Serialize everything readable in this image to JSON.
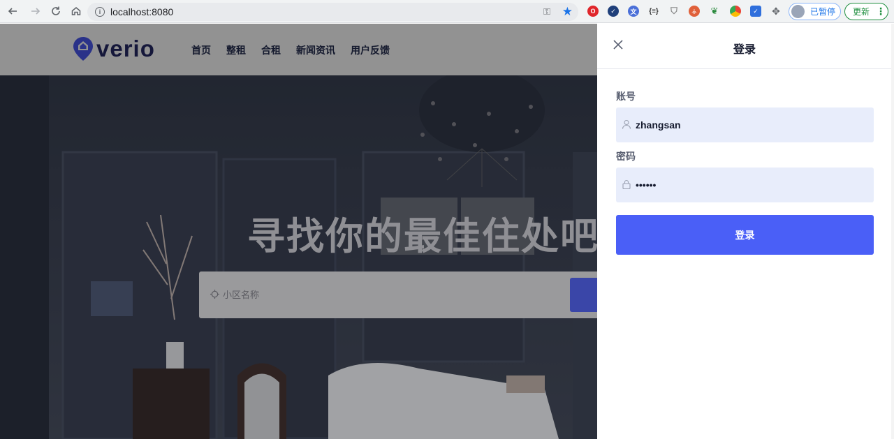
{
  "browser": {
    "url": "localhost:8080",
    "profile_status": "已暂停",
    "update_label": "更新",
    "extensions": [
      "opera-icon",
      "checkmark-icon",
      "translate-icon",
      "json-icon",
      "shield-icon",
      "tree-icon",
      "leaf-icon",
      "chrome-icon",
      "todo-icon",
      "puzzle-icon"
    ]
  },
  "site": {
    "logo_text": "verio",
    "nav": [
      {
        "label": "首页"
      },
      {
        "label": "整租"
      },
      {
        "label": "合租"
      },
      {
        "label": "新闻资讯"
      },
      {
        "label": "用户反馈"
      }
    ],
    "hero_title": "寻找你的最佳住处吧",
    "search_placeholder": "小区名称"
  },
  "login": {
    "title": "登录",
    "account_label": "账号",
    "account_value": "zhangsan",
    "password_label": "密码",
    "password_value": "••••••",
    "submit_label": "登录"
  },
  "colors": {
    "accent": "#4a5ff7",
    "input_bg": "#e8edfb",
    "header_overlay": "#929292"
  }
}
